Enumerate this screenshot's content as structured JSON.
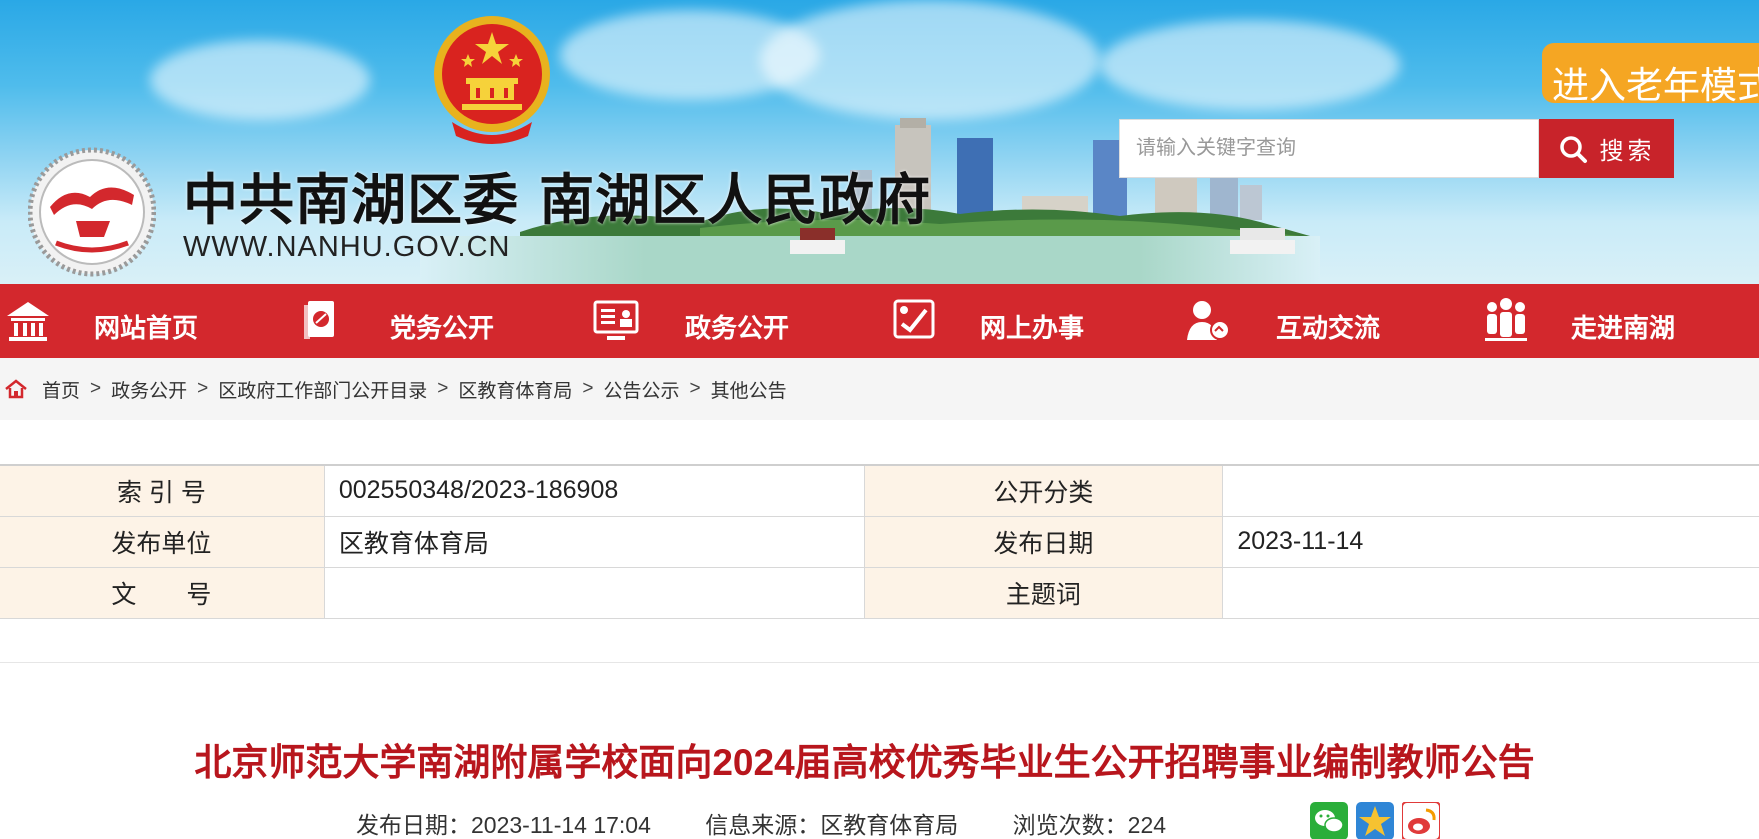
{
  "header": {
    "site_title": "中共南湖区委 南湖区人民政府",
    "site_url": "WWW.NANHU.GOV.CN",
    "elder_mode_label": "进入老年模式",
    "search": {
      "placeholder": "请输入关键字查询",
      "button_label": "搜索"
    }
  },
  "nav": {
    "items": [
      {
        "label": "网站首页",
        "icon": "home-icon"
      },
      {
        "label": "党务公开",
        "icon": "party-icon"
      },
      {
        "label": "政务公开",
        "icon": "gov-affairs-icon"
      },
      {
        "label": "网上办事",
        "icon": "online-service-icon"
      },
      {
        "label": "互动交流",
        "icon": "interaction-icon"
      },
      {
        "label": "走进南湖",
        "icon": "people-icon"
      }
    ]
  },
  "breadcrumb": {
    "separator": ">",
    "items": [
      "首页",
      "政务公开",
      "区政府工作部门公开目录",
      "区教育体育局",
      "公告公示",
      "其他公告"
    ]
  },
  "meta": {
    "rows": [
      {
        "label1": "索 引 号",
        "value1": "002550348/2023-186908",
        "label2": "公开分类",
        "value2": ""
      },
      {
        "label1": "发布单位",
        "value1": "区教育体育局",
        "label2": "发布日期",
        "value2": "2023-11-14"
      },
      {
        "label1": "文　　号",
        "value1": "",
        "label2": "主题词",
        "value2": ""
      }
    ]
  },
  "article": {
    "title": "北京师范大学南湖附属学校面向2024届高校优秀毕业生公开招聘事业编制教师公告",
    "date_label": "发布日期：",
    "date_value": "2023-11-14 17:04",
    "source_label": "信息来源：",
    "source_value": "区教育体育局",
    "views_label": "浏览次数：",
    "views_value": "224",
    "share_icons": [
      "wechat-icon",
      "qzone-icon",
      "weibo-icon"
    ]
  },
  "colors": {
    "nav_red": "#d3282d",
    "title_red": "#b8161d",
    "elder_orange": "#f5a623",
    "search_red": "#c8232a"
  }
}
